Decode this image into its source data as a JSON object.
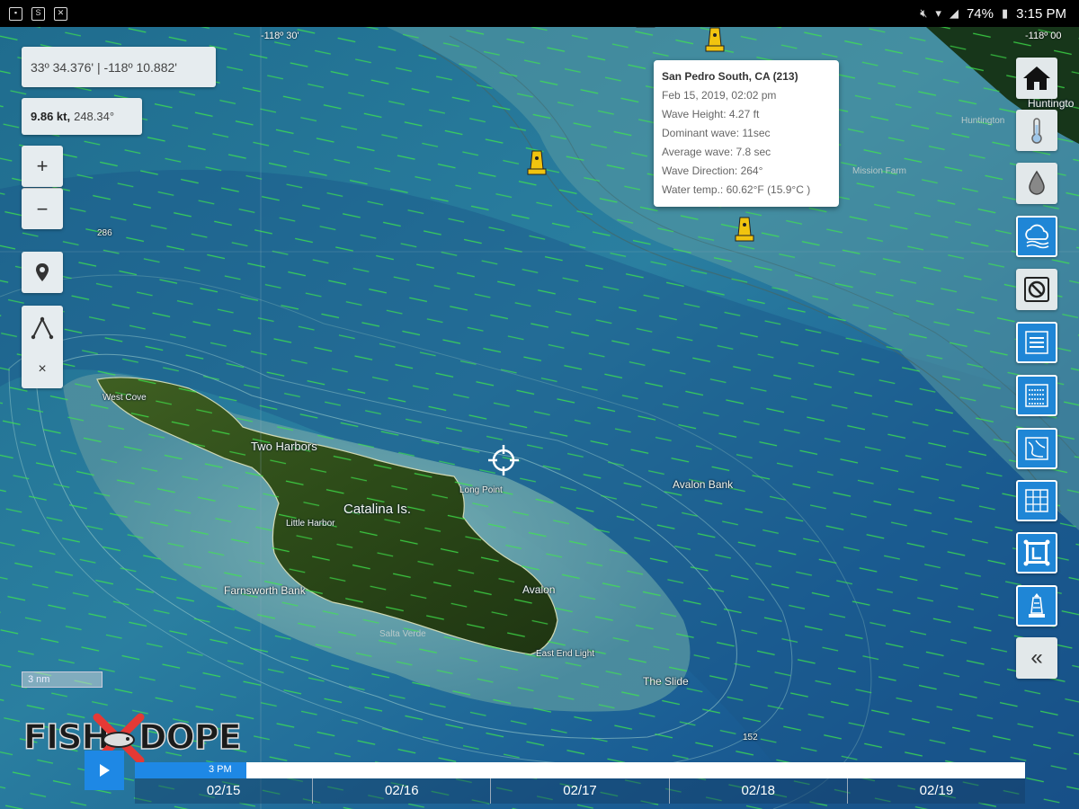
{
  "status_bar": {
    "time": "3:15 PM",
    "battery": "74%",
    "left_icons": [
      "image-notification-icon",
      "s-notification-icon",
      "file-notification-icon"
    ]
  },
  "map": {
    "coord_ticks": [
      "-118º 30'",
      "-118º 00"
    ],
    "depth_labels": [
      "286",
      "152"
    ],
    "places": {
      "west_cove": "West Cove",
      "two_harbors": "Two Harbors",
      "catalina": "Catalina Is.",
      "little_harbor": "Little Harbor",
      "farnsworth": "Farnsworth Bank",
      "avalon": "Avalon",
      "salta_verde": "Salta Verde",
      "east_end_light": "East End Light",
      "long_point": "Long Point",
      "avalon_bank": "Avalon Bank",
      "the_slide": "The Slide",
      "huntington": "Huntingto",
      "huntington_beach": "Huntington",
      "mission_farm": "Mission Farm"
    }
  },
  "panel": {
    "coordinates": "33º 34.376' | -118º 10.882'",
    "speed_value": "9.86 kt,",
    "speed_heading": "248.34°",
    "zoom_in": "+",
    "zoom_out": "−",
    "measure_close": "×"
  },
  "popup": {
    "title": "San Pedro South, CA (213)",
    "date": "Feb 15, 2019, 02:02 pm",
    "wave_height": "Wave Height: 4.27 ft",
    "dominant_wave": "Dominant wave: 11sec",
    "average_wave": "Average wave: 7.8 sec",
    "wave_direction": "Wave Direction: 264°",
    "water_temp": "Water temp.: 60.62°F (15.9°C )"
  },
  "toolbar": [
    "home-icon",
    "thermometer-icon",
    "water-drop-icon",
    "weather-cloud-icon",
    "no-entry-icon",
    "layer-list-icon",
    "layer-grid-icon",
    "chart-layer-icon",
    "grid-icon",
    "logo-frame-icon",
    "lighthouse-icon",
    "collapse-icon"
  ],
  "scale": {
    "label": "3 nm"
  },
  "logo": {
    "left": "FISH",
    "right": "DOPE"
  },
  "timeline": {
    "current_time": "3 PM",
    "progress": 0.125,
    "dates": [
      "02/15",
      "02/16",
      "02/17",
      "02/18",
      "02/19"
    ]
  },
  "colors": {
    "accent": "#1e88e5",
    "land": "#2f4a1c",
    "arrows": "#3ee84a",
    "buoy": "#f1c40f"
  }
}
